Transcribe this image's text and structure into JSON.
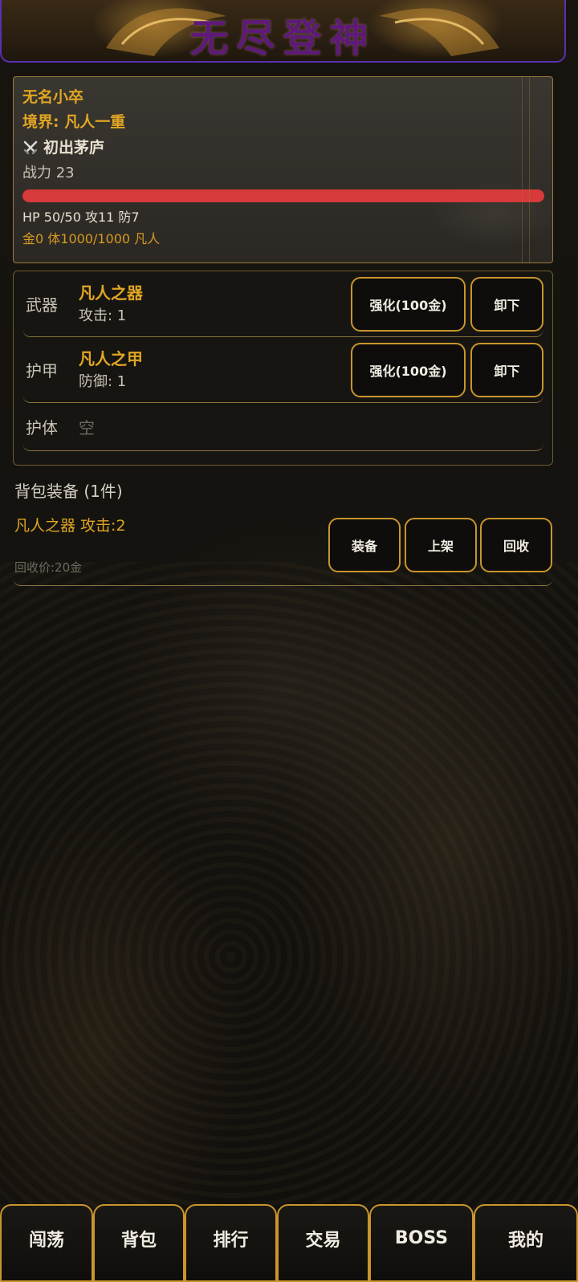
{
  "app": {
    "title": "无尽登神"
  },
  "player": {
    "name": "无名小卒",
    "realm": "境界: 凡人一重",
    "honor_icon": "crossed-swords-icon",
    "honor": "初出茅庐",
    "power": "战力 23",
    "hp_fraction": 1.0,
    "stats": "HP 50/50 攻11 防7",
    "resources": "金0 体1000/1000 凡人"
  },
  "equipment": {
    "slots": [
      {
        "slot": "武器",
        "item": "凡人之器",
        "stat": "攻击: 1",
        "upgrade": "强化(100金)",
        "unequip": "卸下"
      },
      {
        "slot": "护甲",
        "item": "凡人之甲",
        "stat": "防御: 1",
        "upgrade": "强化(100金)",
        "unequip": "卸下"
      },
      {
        "slot": "护体",
        "empty": "空"
      }
    ]
  },
  "bag": {
    "title": "背包装备 (1件)",
    "items": [
      {
        "name": "凡人之器 攻击:2",
        "price": "回收价:20金",
        "equip": "装备",
        "list": "上架",
        "recycle": "回收"
      }
    ]
  },
  "nav": {
    "tabs": [
      "闯荡",
      "背包",
      "排行",
      "交易",
      "BOSS",
      "我的"
    ]
  },
  "colors": {
    "gold": "#e0a623",
    "border": "#c9952c",
    "hp": "#d63a3a",
    "title": "#5e1a78",
    "header_border": "#5b2fb0"
  }
}
